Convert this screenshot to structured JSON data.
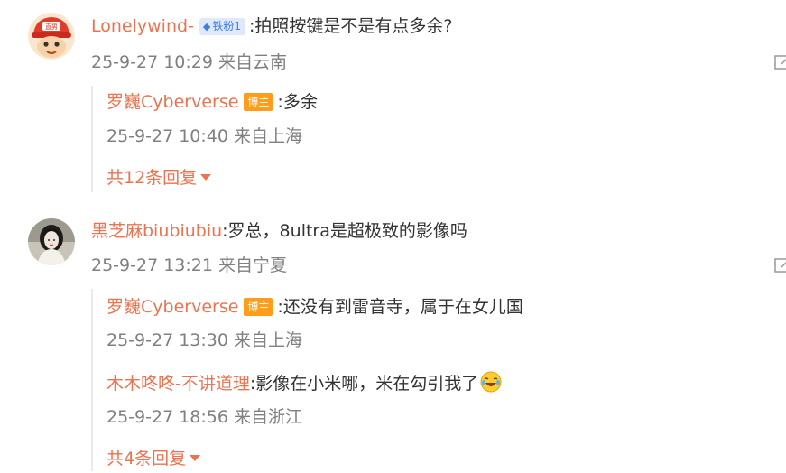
{
  "comments": [
    {
      "username": "Lonelywind-",
      "fan_badge": "铁粉1",
      "avatar_text": "直男",
      "text": ":拍照按键是不是有点多余?",
      "time": "25-9-27 10:29",
      "location": "来自云南",
      "replies": [
        {
          "username": "罗巍Cyberverse",
          "badge": "博主",
          "text": ":多余",
          "time": "25-9-27 10:40",
          "location": "来自上海"
        }
      ],
      "more_replies": "共12条回复"
    },
    {
      "username": "黑芝麻biubiubiu",
      "text": ":罗总，8ultra是超极致的影像吗",
      "time": "25-9-27 13:21",
      "location": "来自宁夏",
      "replies": [
        {
          "username": "罗巍Cyberverse",
          "badge": "博主",
          "text": ":还没有到雷音寺，属于在女儿国",
          "time": "25-9-27 13:30",
          "location": "来自上海"
        },
        {
          "username": "木木咚咚-不讲道理",
          "text": ":影像在小米哪，米在勾引我了",
          "time": "25-9-27 18:56",
          "location": "来自浙江"
        }
      ],
      "more_replies": "共4条回复"
    }
  ],
  "colors": {
    "username": "#eb7350",
    "meta": "#808080",
    "text": "#333333",
    "owner_badge": "#ff9c1a",
    "fan_badge_bg": "#dfe9fb",
    "fan_badge_text": "#3f7ee8"
  },
  "icons": {
    "edit": "edit-icon",
    "caret": "caret-down-icon",
    "emoji": "laugh-cry-emoji-icon"
  }
}
